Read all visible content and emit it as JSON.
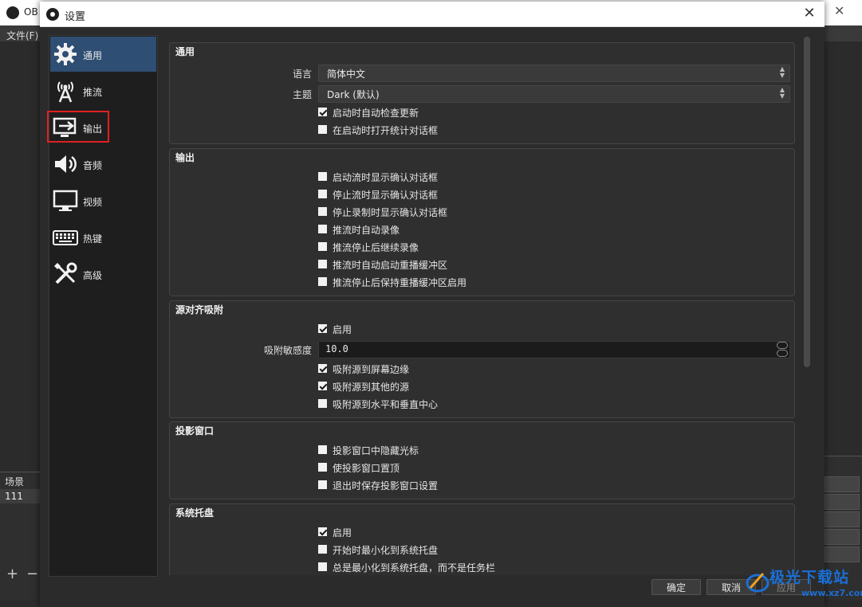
{
  "background_window": {
    "title": "OB",
    "menu_file": "文件(F)",
    "scene_header": "场景",
    "scene_item": "111",
    "add_symbol": "+",
    "remove_symbol": "−"
  },
  "dialog": {
    "title": "设置",
    "close_symbol": "✕"
  },
  "sidebar": {
    "items": [
      {
        "label": "通用",
        "icon": "gear-icon"
      },
      {
        "label": "推流",
        "icon": "broadcast-antenna-icon"
      },
      {
        "label": "输出",
        "icon": "output-monitor-icon"
      },
      {
        "label": "音频",
        "icon": "speaker-icon"
      },
      {
        "label": "视频",
        "icon": "monitor-icon"
      },
      {
        "label": "热键",
        "icon": "keyboard-icon"
      },
      {
        "label": "高级",
        "icon": "tools-icon"
      }
    ],
    "active_index": 0
  },
  "general": {
    "title": "通用",
    "language_label": "语言",
    "language_value": "简体中文",
    "theme_label": "主题",
    "theme_value": "Dark (默认)",
    "check_updates": {
      "label": "启动时自动检查更新",
      "checked": true
    },
    "stats_dialog": {
      "label": "在启动时打开统计对话框",
      "checked": false
    }
  },
  "output": {
    "title": "输出",
    "options": [
      {
        "label": "启动流时显示确认对话框",
        "checked": false
      },
      {
        "label": "停止流时显示确认对话框",
        "checked": false
      },
      {
        "label": "停止录制时显示确认对话框",
        "checked": false
      },
      {
        "label": "推流时自动录像",
        "checked": false
      },
      {
        "label": "推流停止后继续录像",
        "checked": false
      },
      {
        "label": "推流时自动启动重播缓冲区",
        "checked": false
      },
      {
        "label": "推流停止后保持重播缓冲区启用",
        "checked": false
      }
    ]
  },
  "snapping": {
    "title": "源对齐吸附",
    "enable": {
      "label": "启用",
      "checked": true
    },
    "sensitivity_label": "吸附敏感度",
    "sensitivity_value": "10.0",
    "options": [
      {
        "label": "吸附源到屏幕边缘",
        "checked": true
      },
      {
        "label": "吸附源到其他的源",
        "checked": true
      },
      {
        "label": "吸附源到水平和垂直中心",
        "checked": false
      }
    ]
  },
  "projectors": {
    "title": "投影窗口",
    "options": [
      {
        "label": "投影窗口中隐藏光标",
        "checked": false
      },
      {
        "label": "使投影窗口置顶",
        "checked": false
      },
      {
        "label": "退出时保存投影窗口设置",
        "checked": false
      }
    ]
  },
  "system_tray": {
    "title": "系统托盘",
    "options": [
      {
        "label": "启用",
        "checked": true
      },
      {
        "label": "开始时最小化到系统托盘",
        "checked": false
      },
      {
        "label": "总是最小化到系统托盘，而不是任务栏",
        "checked": false
      }
    ]
  },
  "footer": {
    "ok": "确定",
    "cancel": "取消",
    "apply": "应用"
  },
  "watermark": {
    "text": "极光下载站",
    "url": "www.xz7.com"
  },
  "colors": {
    "active_nav": "#2f4e73",
    "highlight": "#e02020",
    "watermark": "#1b6fd6"
  }
}
